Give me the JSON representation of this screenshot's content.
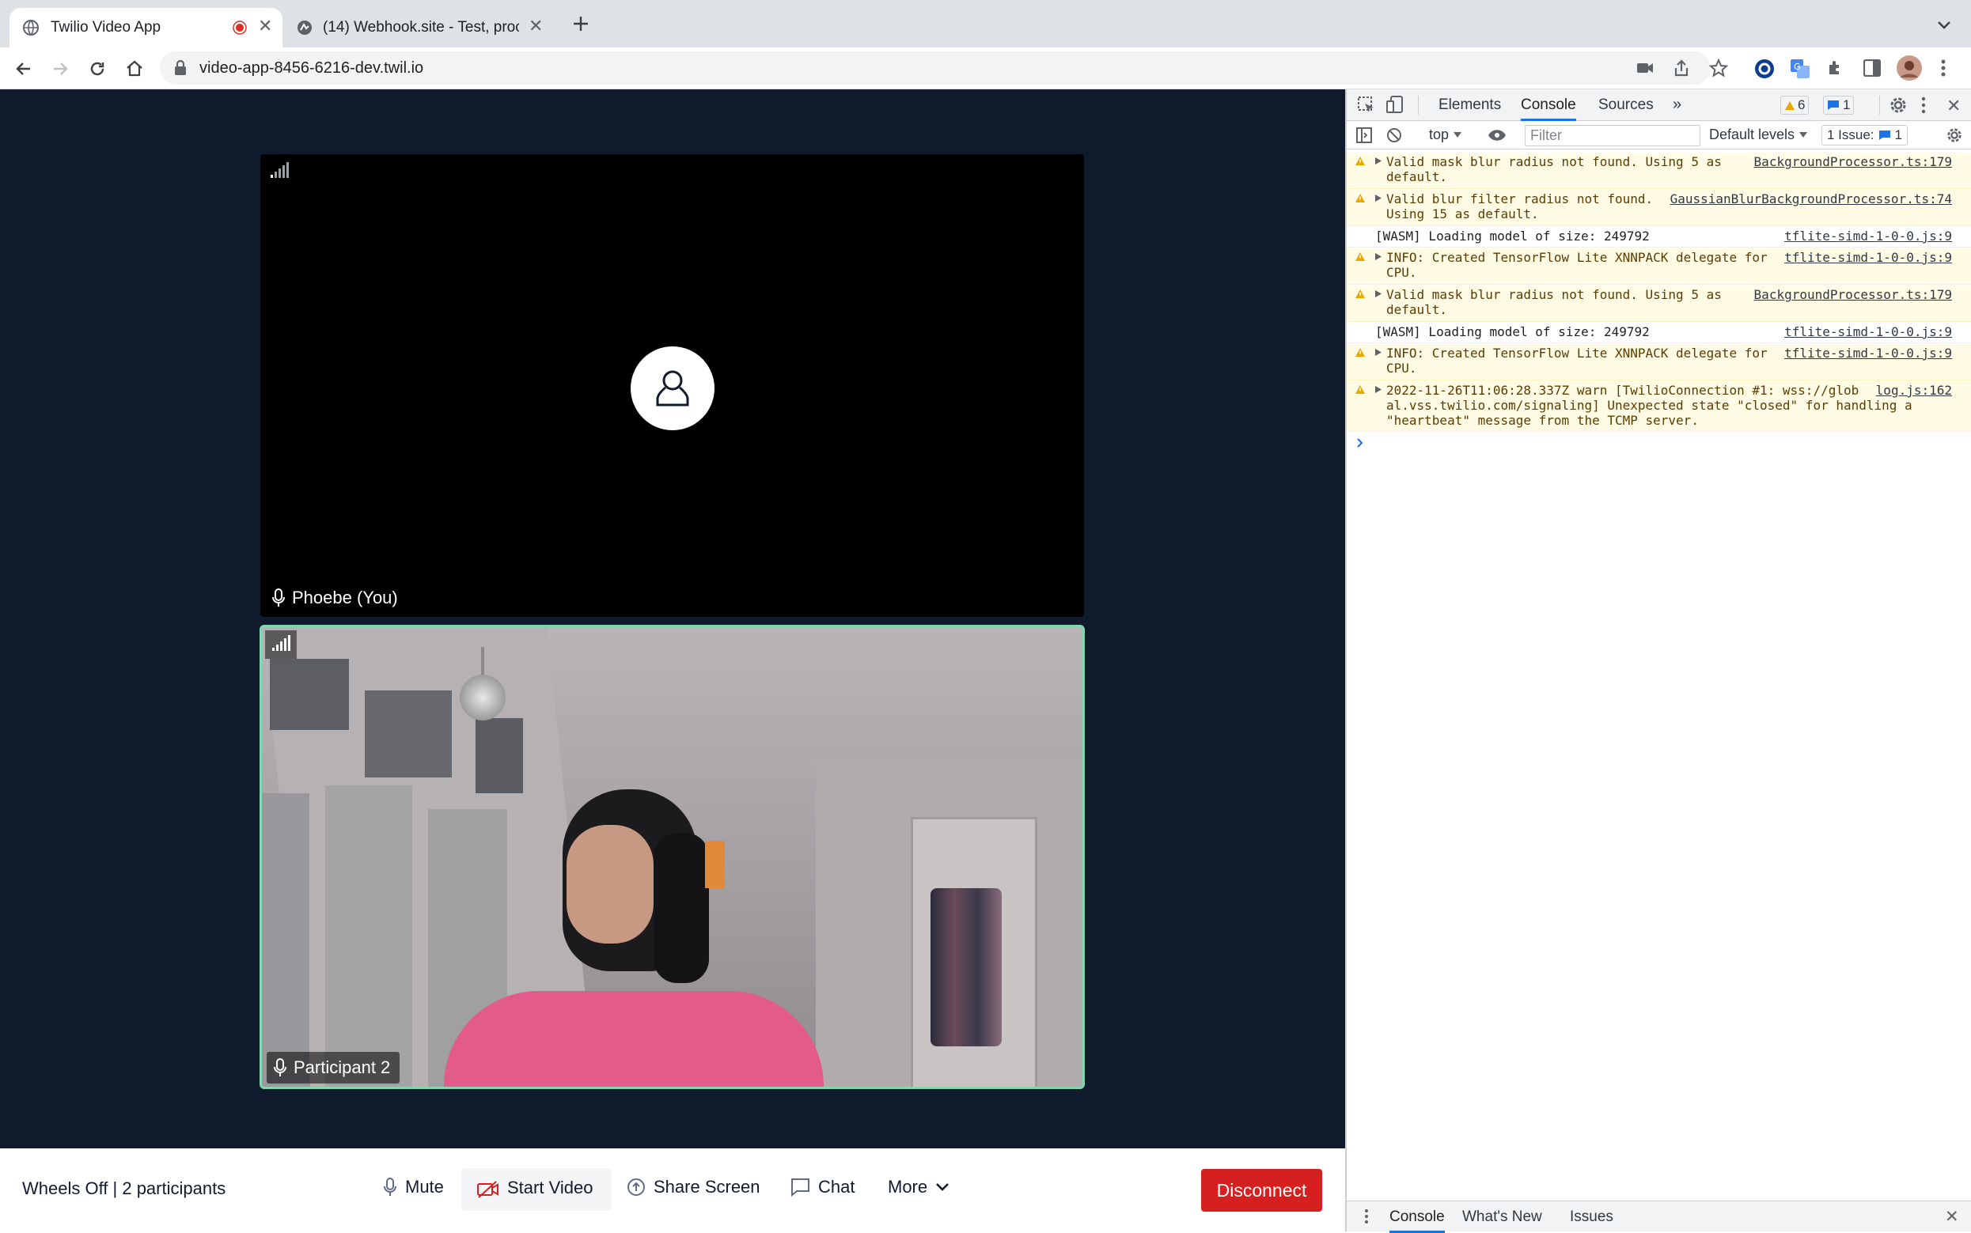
{
  "browser": {
    "tabs": [
      {
        "title": "Twilio Video App",
        "recording": true
      },
      {
        "title": "(14) Webhook.site - Test, proc"
      }
    ],
    "url": "video-app-8456-6216-dev.twil.io"
  },
  "app": {
    "tiles": [
      {
        "name": "Phoebe (You)",
        "video": false,
        "network_bars": 1
      },
      {
        "name": "Participant 2",
        "video": true,
        "dominant": true,
        "network_bars": 5
      }
    ],
    "room_info": "Wheels Off | 2 participants",
    "controls": {
      "mute": "Mute",
      "start_video": "Start Video",
      "share_screen": "Share Screen",
      "chat": "Chat",
      "more": "More",
      "disconnect": "Disconnect"
    },
    "colors": {
      "background": "#0f1b2d",
      "disconnect": "#d61f1f",
      "dominant_border": "#81d8b0"
    }
  },
  "devtools": {
    "tabs": [
      "Elements",
      "Console",
      "Sources"
    ],
    "active_tab": "Console",
    "warnings_count": "6",
    "messages_count": "1",
    "context": "top",
    "filter_placeholder": "Filter",
    "levels": "Default levels",
    "issues_label": "1 Issue:",
    "issues_count": "1",
    "console": [
      {
        "level": "warn",
        "text": "Valid mask blur radius not found. Using 5 as\ndefault.",
        "source": "BackgroundProcessor.ts:179"
      },
      {
        "level": "warn",
        "text": "Valid blur filter radius not found.\nUsing 15 as default.",
        "source": "GaussianBlurBackgroundProcessor.ts:74"
      },
      {
        "level": "info",
        "text": "[WASM] Loading model of size: 249792",
        "source": "tflite-simd-1-0-0.js:9"
      },
      {
        "level": "warn",
        "text": "INFO: Created TensorFlow Lite XNNPACK delegate for\nCPU.",
        "source": "tflite-simd-1-0-0.js:9"
      },
      {
        "level": "warn",
        "text": "Valid mask blur radius not found. Using 5 as\ndefault.",
        "source": "BackgroundProcessor.ts:179"
      },
      {
        "level": "info",
        "text": "[WASM] Loading model of size: 249792",
        "source": "tflite-simd-1-0-0.js:9"
      },
      {
        "level": "warn",
        "text": "INFO: Created TensorFlow Lite XNNPACK delegate for\nCPU.",
        "source": "tflite-simd-1-0-0.js:9"
      },
      {
        "level": "warn",
        "text": "2022-11-26T11:06:28.337Z warn [TwilioConnection #1: wss://glob\nal.vss.twilio.com/signaling] Unexpected state \"closed\" for handling a\n\"heartbeat\" message from the TCMP server.",
        "source": "log.js:162"
      }
    ],
    "drawer_tabs": [
      "Console",
      "What's New",
      "Issues"
    ]
  }
}
